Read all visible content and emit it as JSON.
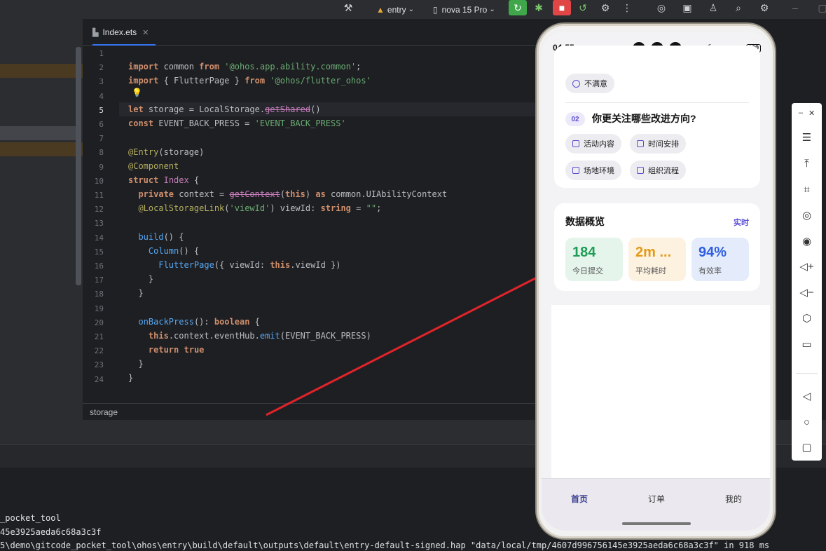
{
  "toolbar": {
    "run_config": "entry",
    "device": "nova 15 Pro"
  },
  "editor": {
    "tab_name": "Index.ets",
    "line_numbers": [
      "1",
      "2",
      "3",
      "4",
      "5",
      "6",
      "7",
      "8",
      "9",
      "10",
      "11",
      "12",
      "13",
      "14",
      "15",
      "16",
      "17",
      "18",
      "19",
      "20",
      "21",
      "22",
      "23",
      "24"
    ],
    "breadcrumb": "storage"
  },
  "output": {
    "lines": [
      "_pocket_tool",
      "45e3925aeda6c68a3c3f",
      "5\\demo\\gitcode_pocket_tool\\ohos\\entry\\build\\default\\outputs\\default\\entry-default-signed.hap \"data/local/tmp/4607d996756145e3925aeda6c68a3c3f\" in 918 ms"
    ]
  },
  "phone": {
    "status": {
      "time": "04:55",
      "battery": "100"
    },
    "survey": {
      "option_dissatisfied": "不满意",
      "q2_badge": "02",
      "q2_title": "你更关注哪些改进方向?",
      "options": [
        "活动内容",
        "时间安排",
        "场地环境",
        "组织流程"
      ]
    },
    "overview": {
      "title": "数据概览",
      "realtime": "实时",
      "stats": [
        {
          "value": "184",
          "label": "今日提交",
          "color": "#1f9d57",
          "bg": "#e6f5ec"
        },
        {
          "value": "2m ...",
          "label": "平均耗时",
          "color": "#e39a14",
          "bg": "#fdf1e0"
        },
        {
          "value": "94%",
          "label": "有效率",
          "color": "#2f5ee0",
          "bg": "#e4ecfb"
        }
      ]
    },
    "nav": [
      "首页",
      "订单",
      "我的"
    ]
  },
  "colors": {
    "accent": "#5b4fd1",
    "arrow": "#e0242a",
    "run_green": "#3fa64a",
    "stop_red": "#e04646"
  }
}
